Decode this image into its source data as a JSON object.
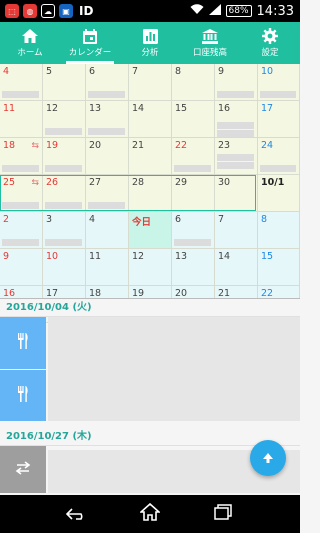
{
  "status_bar": {
    "app_id": "ID",
    "battery": "68%",
    "time": "14:33"
  },
  "tabs": [
    {
      "label": "ホーム",
      "icon": "home-icon"
    },
    {
      "label": "カレンダー",
      "icon": "calendar-icon",
      "active": true
    },
    {
      "label": "分析",
      "icon": "chart-icon"
    },
    {
      "label": "口座残高",
      "icon": "bank-icon"
    },
    {
      "label": "設定",
      "icon": "gear-icon"
    }
  ],
  "calendar": {
    "weeks": [
      {
        "bg": "#f4f7e2",
        "days": [
          {
            "label": "4",
            "color": "red"
          },
          {
            "label": "5"
          },
          {
            "label": "6"
          },
          {
            "label": "7"
          },
          {
            "label": "8"
          },
          {
            "label": "9"
          },
          {
            "label": "10",
            "color": "blue"
          }
        ]
      },
      {
        "bg": "#f4f7e2",
        "days": [
          {
            "label": "11",
            "color": "red"
          },
          {
            "label": "12"
          },
          {
            "label": "13"
          },
          {
            "label": "14"
          },
          {
            "label": "15"
          },
          {
            "label": "16"
          },
          {
            "label": "17",
            "color": "blue"
          }
        ]
      },
      {
        "bg": "#f4f7e2",
        "days": [
          {
            "label": "18",
            "color": "red"
          },
          {
            "label": "19",
            "color": "red"
          },
          {
            "label": "20"
          },
          {
            "label": "21"
          },
          {
            "label": "22",
            "color": "red"
          },
          {
            "label": "23"
          },
          {
            "label": "24",
            "color": "blue"
          }
        ]
      },
      {
        "bg": "#f4f7e2",
        "days": [
          {
            "label": "25",
            "color": "red"
          },
          {
            "label": "26",
            "color": "red"
          },
          {
            "label": "27"
          },
          {
            "label": "28"
          },
          {
            "label": "29"
          },
          {
            "label": "30"
          },
          {
            "label": "10/1",
            "bold": true
          }
        ]
      },
      {
        "bg": "#e6f7fa",
        "days": [
          {
            "label": "2",
            "color": "red"
          },
          {
            "label": "3"
          },
          {
            "label": "4"
          },
          {
            "label": "今日",
            "today": true
          },
          {
            "label": "6"
          },
          {
            "label": "7"
          },
          {
            "label": "8",
            "color": "blue"
          }
        ]
      },
      {
        "bg": "#e6f7fa",
        "days": [
          {
            "label": "9",
            "color": "red"
          },
          {
            "label": "10",
            "color": "red"
          },
          {
            "label": "11"
          },
          {
            "label": "12"
          },
          {
            "label": "13"
          },
          {
            "label": "14"
          },
          {
            "label": "15",
            "color": "blue"
          }
        ]
      },
      {
        "bg": "#e6f7fa",
        "days": [
          {
            "label": "16",
            "color": "red"
          },
          {
            "label": "17"
          },
          {
            "label": "18"
          },
          {
            "label": "19"
          },
          {
            "label": "20"
          },
          {
            "label": "21"
          },
          {
            "label": "22",
            "color": "blue"
          }
        ]
      }
    ]
  },
  "entries": [
    {
      "date": "2016/10/04 (火)",
      "items": [
        {
          "icon": "fork-knife-icon",
          "color": "#64b5f6"
        },
        {
          "icon": "fork-knife-icon",
          "color": "#64b5f6"
        }
      ]
    },
    {
      "date": "2016/10/27 (木)",
      "items": [
        {
          "icon": "transfer-icon",
          "color": "#9e9e9e"
        }
      ]
    }
  ],
  "colors": {
    "accent": "#1fbfa0",
    "fab": "#29a9e8"
  }
}
